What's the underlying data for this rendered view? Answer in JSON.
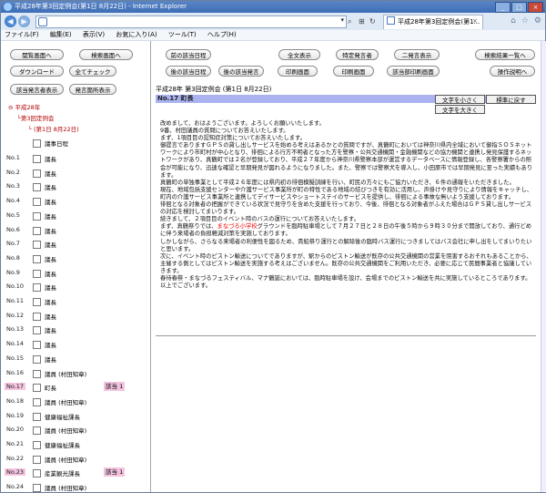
{
  "window": {
    "title": "平成28年第3回定例会(第1日 8月22日) - Internet Explorer"
  },
  "browser": {
    "tab_title": "平成28年第3回定例会(第1...",
    "back": "◀",
    "forward": "▶",
    "address": ""
  },
  "menu": [
    "ファイル(F)",
    "編集(E)",
    "表示(V)",
    "お気に入り(A)",
    "ツール(T)",
    "ヘルプ(H)"
  ],
  "left_buttons": {
    "row1": [
      "閲覧画面へ",
      "検索画面へ"
    ],
    "row2": [
      "ダウンロード",
      "全てチェック"
    ],
    "row3": [
      "該当発言者表示",
      "発言箇所表示"
    ]
  },
  "tree": {
    "year": "平成28年",
    "session": "第3回定例会",
    "day": "(第1日 8月22日)"
  },
  "agenda": "議事日程",
  "rows": [
    {
      "no": "No.1",
      "name": "議長"
    },
    {
      "no": "No.2",
      "name": "議長"
    },
    {
      "no": "No.3",
      "name": "議長"
    },
    {
      "no": "No.4",
      "name": "議長"
    },
    {
      "no": "No.5",
      "name": "議長"
    },
    {
      "no": "No.6",
      "name": "議長"
    },
    {
      "no": "No.7",
      "name": "議長"
    },
    {
      "no": "No.8",
      "name": "議長"
    },
    {
      "no": "No.9",
      "name": "議長"
    },
    {
      "no": "No.10",
      "name": "議長"
    },
    {
      "no": "No.11",
      "name": "議長"
    },
    {
      "no": "No.12",
      "name": "議長"
    },
    {
      "no": "No.13",
      "name": "議長"
    },
    {
      "no": "No.14",
      "name": "議長"
    },
    {
      "no": "No.15",
      "name": "議長"
    },
    {
      "no": "No.16",
      "name": "議員 (村田知章)"
    },
    {
      "no": "No.17",
      "name": "町長",
      "hl": true,
      "badge": "該当 1"
    },
    {
      "no": "No.18",
      "name": "議員 (村田知章)"
    },
    {
      "no": "No.19",
      "name": "健康福祉課長"
    },
    {
      "no": "No.20",
      "name": "議員 (村田知章)"
    },
    {
      "no": "No.21",
      "name": "健康福祉課長"
    },
    {
      "no": "No.22",
      "name": "議員 (村田知章)"
    },
    {
      "no": "No.23",
      "name": "産業観光課長",
      "hl": true,
      "badge": "該当 1"
    },
    {
      "no": "No.24",
      "name": "議員 (村田知章)"
    }
  ],
  "right_buttons": {
    "row1": [
      "前の該当日程",
      "全文表示",
      "特定発言者",
      "二発言表示",
      "検索結果一覧へ"
    ],
    "row2": [
      "後の該当日程",
      "後の該当発言",
      "印刷画面",
      "印刷画面",
      "該当部印刷画面",
      "操作説明へ"
    ]
  },
  "page": {
    "heading": "平成28年 第3回定例会 (第1日 8月22日)",
    "speaker": "No.17 町長",
    "btn_small": "文字を小さく",
    "btn_reset": "標準に戻す",
    "btn_large": "文字を大きく",
    "body": [
      "改めまして、おはようございます。よろしくお願いいたします。",
      "9番、村田議員の質問についてお答えいたします。",
      "まず、1項目目の認知症対策についてお答えいたします。",
      "御提言でありますＧＰＳの貸し出しサービスを始める考えはあるかとの質問ですが、真鶴町においては神奈川県内全域において御指ＳＯＳネットワークにより市町村が中心となり、徘徊による行方不明者となった方を警察・公共交通機関・金融機関などの協力機関と連携し発見保護するネットワークがあり、真鶴町では２名が登録しており、平成２７年度から神奈川県警察本部が運営するデータベースに情報登録し、各警察署からの照会が可能になり、迅速な確認と早期発見が図れるようになりました。また、警察では警察犬を導入し、小田原市では早期発見に至った実績もあります。",
      "真鶴町の単独事業として平成２６年度には県内初の徘徊模擬訓練を行い、町民の方々にもご協力いただき、６件の通報をいただきました。",
      "現在、地域包括支援センターや介護サービス事業所が町の特性である地域の結びつきを有効に活用し、声掛けや見守りにより情報をキャッチし、町内の介護サービス事業所と連携してデイサービスやショートステイのサービスを提供し、徘徊による事故な無いよう支援しております。",
      "徘徊となる対象者の把握ができている状況で見守りを含めた支援を行っており、今後、徘徊となる対象者がふえた場合はＧＰＳ貸し出しサービスの対応を検討してまいります。",
      "続きまして、２項目目のイベント時のバスの運行についてお答えいたします。",
      "まず、真鶴祭りでは、",
      "まなづる小学校",
      "グラウンドを臨時駐車場として７月２７日と２８日の午後５時から９時３０分まで開放しており、通行どめに伴う来場者の負担軽減対策を実施しております。",
      "しかしながら、さらなる来場者の利便性を図るため、貴船祭り運行との解除後の臨時バス運行につきましてはバス会社に申し出をしてまいりたいと思います。",
      "次に、イベント時のピストン輸送についてでありますが、駅からのピストン輸送が既存の公共交通機関の営業を阻害するおそれもあることから、主催する側としてはピストン輸送を実施する考えはございません。既存の公共交通機関をご利用いただき、必要に応じて民間事業者と協議していきます。",
      "春待春祭・まなづるフェスティバル、マナ鶴誕においては、臨時駐車場を設け、会場までのピストン輸送を共に実施しているところであります。",
      "以上でございます。"
    ]
  }
}
